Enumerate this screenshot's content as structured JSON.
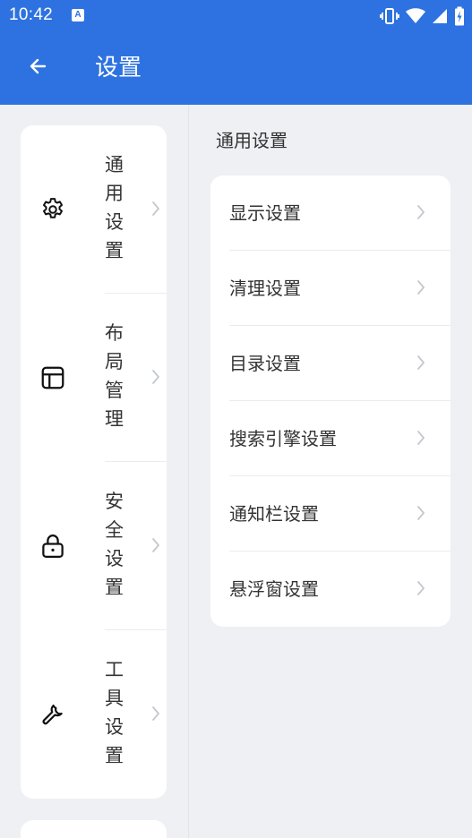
{
  "status_bar": {
    "time": "10:42",
    "notification_icon": "A",
    "icons": [
      "vibrate-icon",
      "wifi-icon",
      "signal-icon",
      "battery-charging-icon"
    ]
  },
  "app_bar": {
    "back_icon": "arrow-left-icon",
    "title": "设置"
  },
  "nav": {
    "items": [
      {
        "label": "通用设置",
        "icon": "gear-icon"
      },
      {
        "label": "布局管理",
        "icon": "layout-icon"
      },
      {
        "label": "安全设置",
        "icon": "lock-icon"
      },
      {
        "label": "工具设置",
        "icon": "wrench-icon"
      }
    ]
  },
  "content": {
    "section_title": "通用设置",
    "items": [
      {
        "label": "显示设置"
      },
      {
        "label": "清理设置"
      },
      {
        "label": "目录设置"
      },
      {
        "label": "搜索引擎设置"
      },
      {
        "label": "通知栏设置"
      },
      {
        "label": "悬浮窗设置"
      }
    ]
  },
  "colors": {
    "primary": "#2d72e0",
    "background": "#eef0f4",
    "card": "#ffffff",
    "chevron": "#c4c8ce"
  }
}
